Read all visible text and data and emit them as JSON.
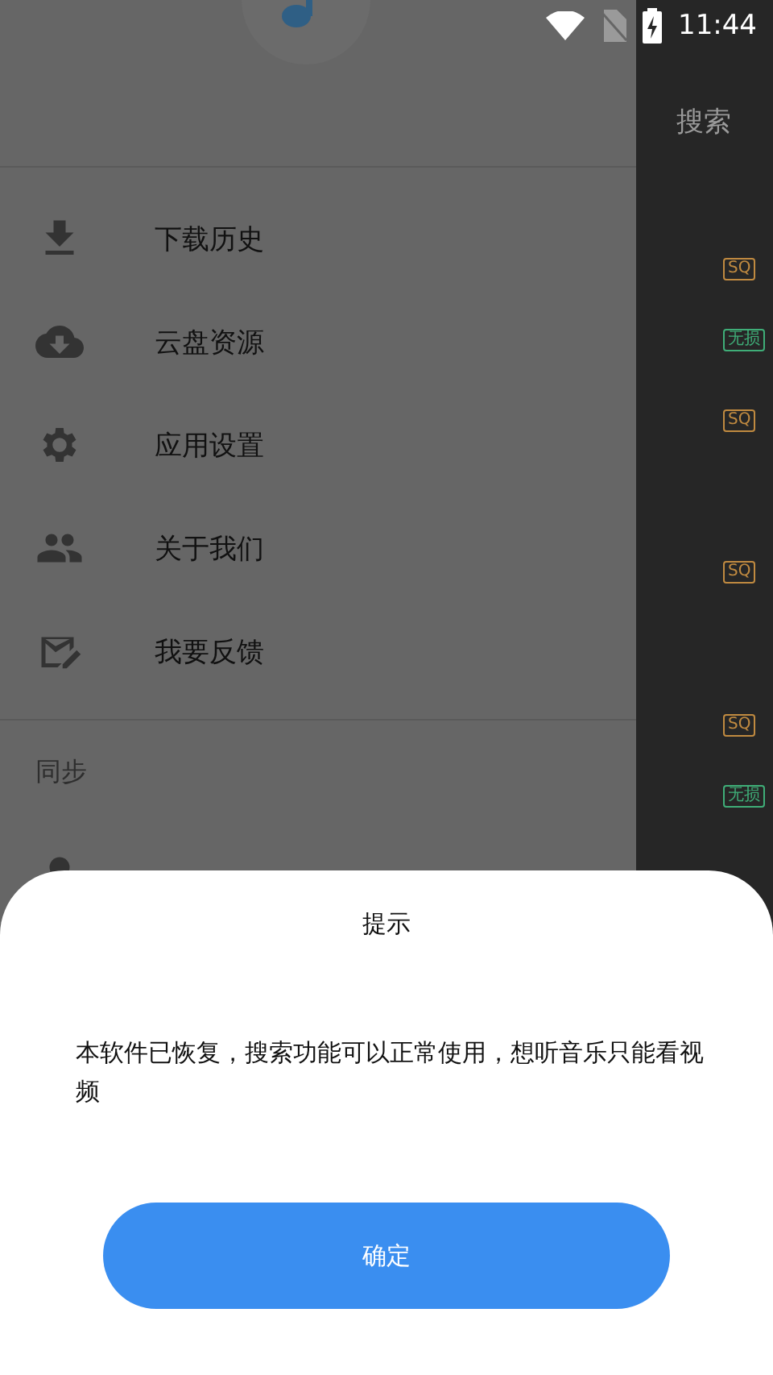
{
  "status_bar": {
    "time": "11:44"
  },
  "background_app": {
    "search_button": "搜索",
    "tags": [
      {
        "label": "SQ",
        "kind": "sq"
      },
      {
        "label": "无损",
        "kind": "lossless"
      },
      {
        "label": "SQ",
        "kind": "sq"
      },
      {
        "label": "SQ",
        "kind": "sq"
      },
      {
        "label": "SQ",
        "kind": "sq"
      },
      {
        "label": "无损",
        "kind": "lossless"
      }
    ]
  },
  "drawer": {
    "items": [
      {
        "label": "下载历史"
      },
      {
        "label": "云盘资源"
      },
      {
        "label": "应用设置"
      },
      {
        "label": "关于我们"
      },
      {
        "label": "我要反馈"
      }
    ],
    "section": "同步"
  },
  "dialog": {
    "title": "提示",
    "message": "本软件已恢复，搜索功能可以正常使用，想听音乐只能看视频",
    "button": "确定"
  }
}
